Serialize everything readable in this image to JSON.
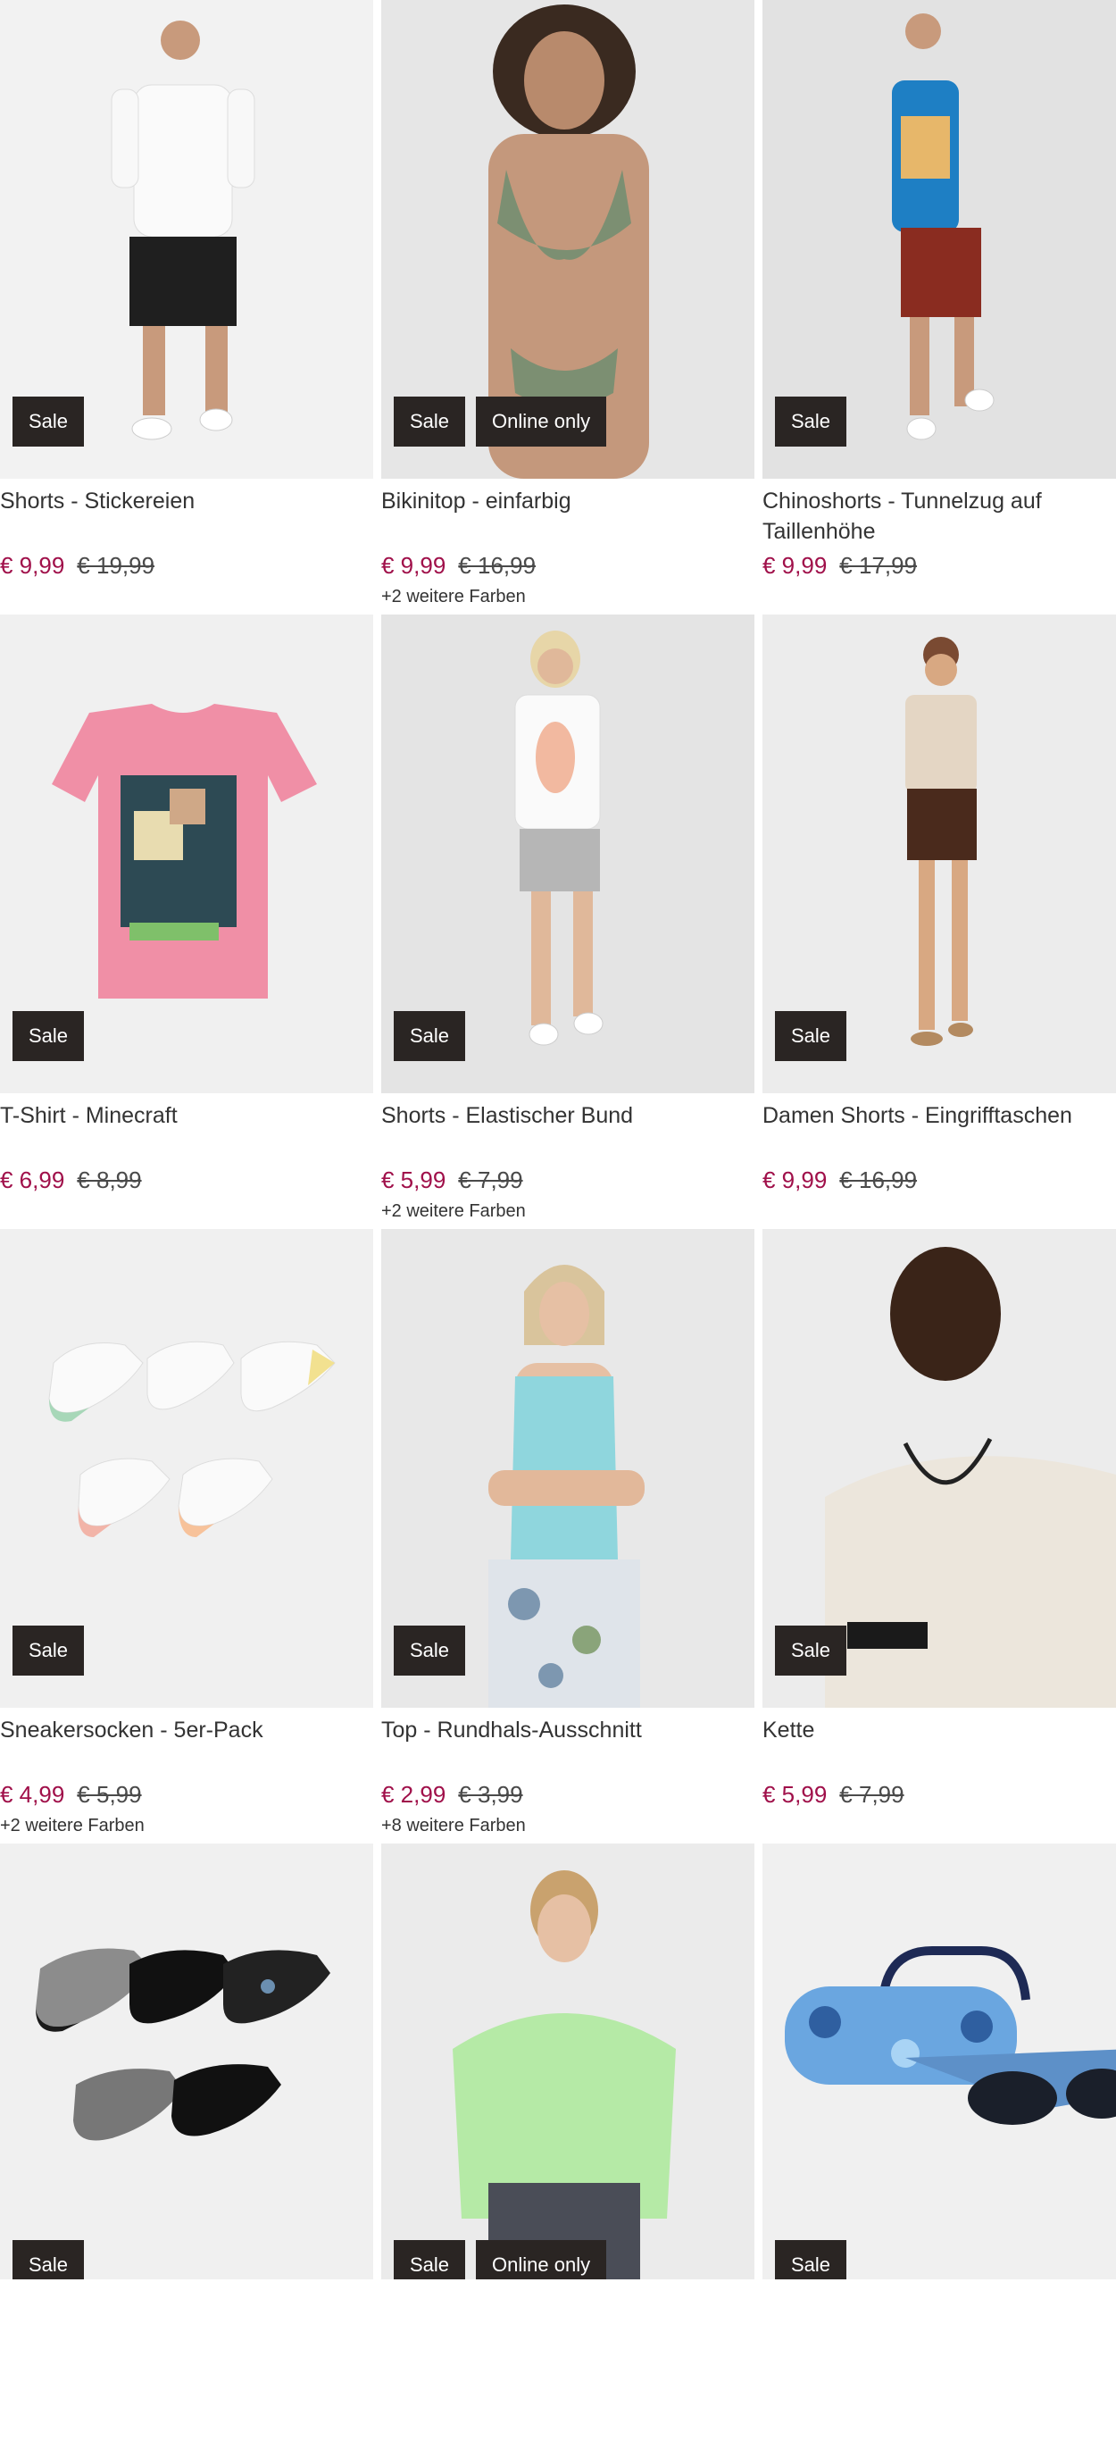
{
  "products": [
    {
      "title": "Shorts - Stickereien",
      "price": "€ 9,99",
      "old_price": "€ 19,99",
      "colors": "",
      "badges": [
        "Sale"
      ],
      "bg": "#f2f2f2"
    },
    {
      "title": "Bikinitop - einfarbig",
      "price": "€ 9,99",
      "old_price": "€ 16,99",
      "colors": "+2 weitere Farben",
      "badges": [
        "Sale",
        "Online only"
      ],
      "bg": "#e6e6e6"
    },
    {
      "title": "Chinoshorts - Tunnelzug auf Taillenhöhe",
      "price": "€ 9,99",
      "old_price": "€ 17,99",
      "colors": "",
      "badges": [
        "Sale"
      ],
      "bg": "#e2e2e2"
    },
    {
      "title": "T-Shirt - Minecraft",
      "price": "€ 6,99",
      "old_price": "€ 8,99",
      "colors": "",
      "badges": [
        "Sale"
      ],
      "bg": "#f0f0f0"
    },
    {
      "title": "Shorts - Elastischer Bund",
      "price": "€ 5,99",
      "old_price": "€ 7,99",
      "colors": "+2 weitere Farben",
      "badges": [
        "Sale"
      ],
      "bg": "#e4e4e4"
    },
    {
      "title": "Damen Shorts - Eingrifftaschen",
      "price": "€ 9,99",
      "old_price": "€ 16,99",
      "colors": "",
      "badges": [
        "Sale"
      ],
      "bg": "#ececec"
    },
    {
      "title": "Sneakersocken - 5er-Pack",
      "price": "€ 4,99",
      "old_price": "€ 5,99",
      "colors": "+2 weitere Farben",
      "badges": [
        "Sale"
      ],
      "bg": "#f0f0f0"
    },
    {
      "title": "Top - Rundhals-Ausschnitt",
      "price": "€ 2,99",
      "old_price": "€ 3,99",
      "colors": "+8 weitere Farben",
      "badges": [
        "Sale"
      ],
      "bg": "#e8e8e8"
    },
    {
      "title": "Kette",
      "price": "€ 5,99",
      "old_price": "€ 7,99",
      "colors": "",
      "badges": [
        "Sale"
      ],
      "bg": "#ececec"
    },
    {
      "title": "",
      "price": "",
      "old_price": "",
      "colors": "",
      "badges": [
        "Sale"
      ],
      "bg": "#f0f0f0"
    },
    {
      "title": "",
      "price": "",
      "old_price": "",
      "colors": "",
      "badges": [
        "Sale",
        "Online only"
      ],
      "bg": "#ebebeb"
    },
    {
      "title": "",
      "price": "",
      "old_price": "",
      "colors": "",
      "badges": [
        "Sale"
      ],
      "bg": "#f0f0f0"
    }
  ],
  "colors": {
    "sale_price": "#a0104a",
    "badge_bg": "#2a2523"
  }
}
